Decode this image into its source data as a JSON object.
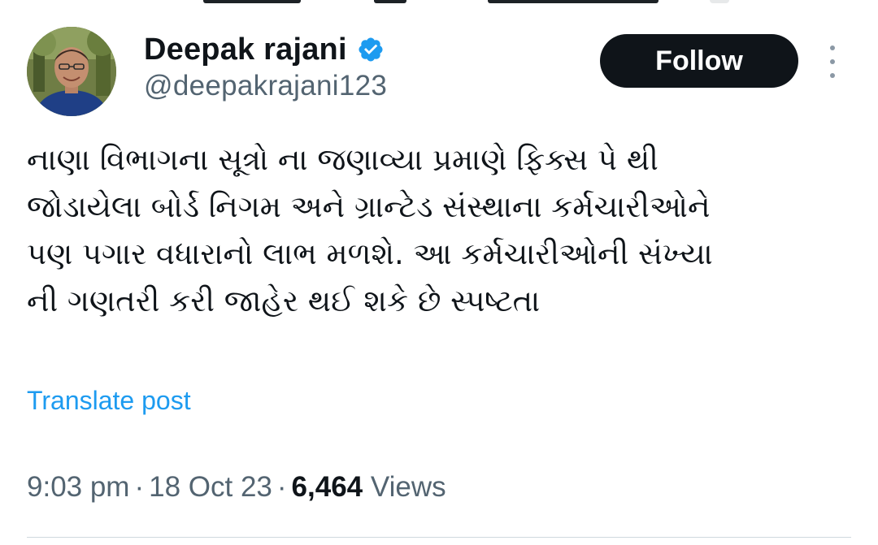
{
  "author": {
    "display_name": "Deepak rajani",
    "handle": "@deepakrajani123",
    "verified": true
  },
  "actions": {
    "follow_label": "Follow",
    "more_icon": "more-vertical-icon"
  },
  "post": {
    "text_lines": [
      "નાણા વિભાગના સૂત્રો ના જણાવ્યા પ્રમાણે ફિક્સ પે થી",
      "જોડાયેલા બોર્ડ નિગમ અને ગ્રાન્ટેડ સંસ્થાના કર્મચારીઓને",
      "પણ પગાર વધારાનો લાભ મળશે. આ કર્મચારીઓની સંખ્યા",
      "ની ગણતરી કરી જાહેર થઈ શકે છે સ્પષ્ટતા"
    ],
    "translate_label": "Translate post"
  },
  "meta": {
    "time": "9:03 pm",
    "separator": "·",
    "date": "18 Oct 23",
    "views_count": "6,464",
    "views_label": "Views"
  },
  "colors": {
    "text_primary": "#0f1419",
    "text_secondary": "#536471",
    "link": "#1d9bf0",
    "verified_badge": "#1d9bf0",
    "follow_bg": "#0f1419",
    "follow_text": "#ffffff",
    "divider": "#cfd9de"
  }
}
